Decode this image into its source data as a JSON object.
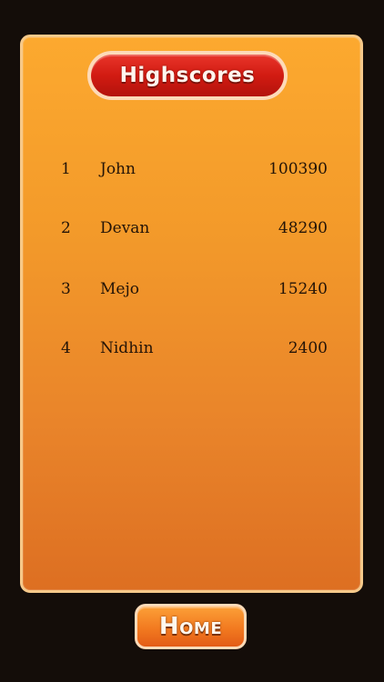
{
  "title": "Highscores",
  "scores": [
    {
      "rank": "1",
      "name": "John",
      "score": "100390"
    },
    {
      "rank": "2",
      "name": "Devan",
      "score": "48290"
    },
    {
      "rank": "3",
      "name": "Mejo",
      "score": "15240"
    },
    {
      "rank": "4",
      "name": "Nidhin",
      "score": "2400"
    }
  ],
  "home_label": "Home",
  "colors": {
    "background": "#140d09",
    "panel_top": "#fca92f",
    "panel_bottom": "#dd6f22",
    "title_red": "#d21b12",
    "button_orange": "#f27a20"
  }
}
